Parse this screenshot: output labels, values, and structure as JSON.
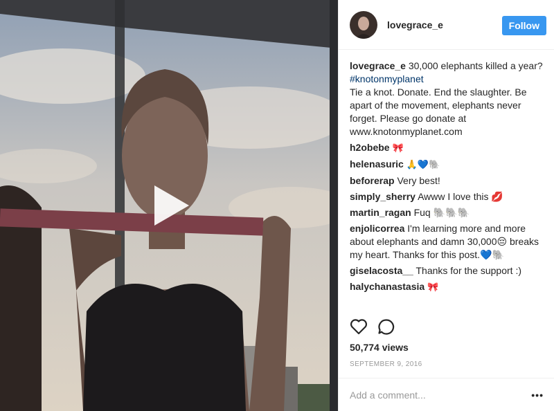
{
  "post": {
    "username": "lovegrace_e",
    "follow_label": "Follow",
    "caption": {
      "user": "lovegrace_e",
      "text_a": "30,000 elephants killed a year?",
      "hashtag": "#knotonmyplanet",
      "text_b": "Tie a knot. Donate. End the slaughter. Be apart of the movement, elephants never forget. Please go donate at www.knotonmyplanet.com"
    },
    "comments": [
      {
        "user": "h2obebe",
        "text": "🎀"
      },
      {
        "user": "helenasuric",
        "text": "🙏💙🐘"
      },
      {
        "user": "beforerap",
        "text": "Very best!"
      },
      {
        "user": "simply_sherry",
        "text": "Awww I love this 💋"
      },
      {
        "user": "martin_ragan",
        "text": "Fuq 🐘🐘🐘"
      },
      {
        "user": "enjolicorrea",
        "text": "I'm learning more and more about elephants and damn 30,000😔 breaks my heart. Thanks for this post.💙🐘"
      },
      {
        "user": "giselacosta__",
        "text": "Thanks for the support :)"
      },
      {
        "user": "halychanastasia",
        "text": "🎀"
      }
    ],
    "views": "50,774 views",
    "date": "SEPTEMBER 9, 2016",
    "add_comment_placeholder": "Add a comment...",
    "more_label": "•••"
  },
  "icons": {
    "play": "play-icon",
    "like": "heart-icon",
    "comment": "comment-icon",
    "more": "more-options-icon"
  },
  "colors": {
    "follow_bg": "#3897f0",
    "hashtag": "#003569",
    "muted": "#999999"
  }
}
